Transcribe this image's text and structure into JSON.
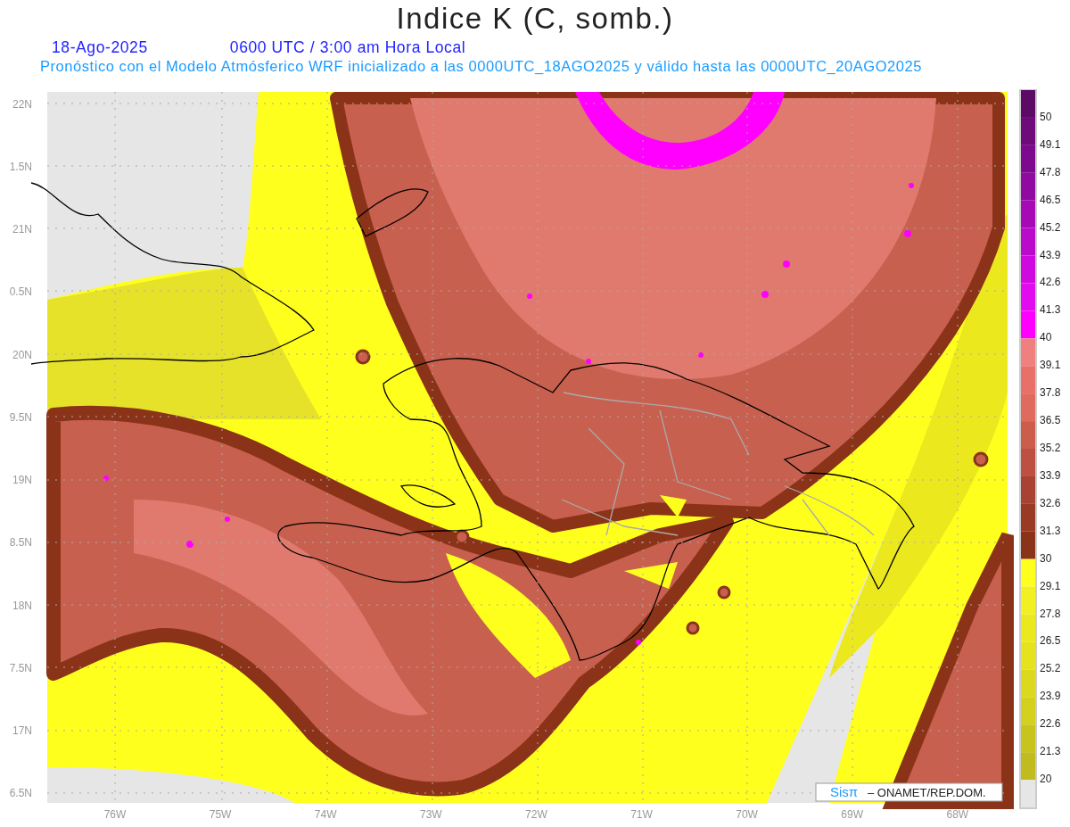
{
  "title": "Indice K (C, somb.)",
  "date": "18-Ago-2025",
  "time": "0600 UTC / 3:00 am Hora Local",
  "subtitle": "Pronóstico con el Modelo Atmósferico WRF inicializado a las 0000UTC_18AGO2025 y válido hasta las  0000UTC_20AGO2025",
  "map": {
    "y_ticks": [
      "22N",
      "1.5N",
      "21N",
      "0.5N",
      "20N",
      "9.5N",
      "19N",
      "8.5N",
      "18N",
      "7.5N",
      "17N",
      "6.5N"
    ],
    "x_ticks": [
      "76W",
      "75W",
      "74W",
      "73W",
      "72W",
      "71W",
      "70W",
      "69W",
      "68W"
    ]
  },
  "colorbar": {
    "steps": [
      {
        "color": "#5c0a66"
      },
      {
        "color": "#6e0a7a"
      },
      {
        "color": "#7d0a8e"
      },
      {
        "color": "#900aa2"
      },
      {
        "color": "#a50ab6"
      },
      {
        "color": "#ba0aca"
      },
      {
        "color": "#cf0ade"
      },
      {
        "color": "#e20aee"
      },
      {
        "color": "#ff00ff"
      },
      {
        "color": "#f08080"
      },
      {
        "color": "#e87068"
      },
      {
        "color": "#e06a5e"
      },
      {
        "color": "#cc5c4c"
      },
      {
        "color": "#bd5040"
      },
      {
        "color": "#a84232"
      },
      {
        "color": "#983a24"
      },
      {
        "color": "#8b3318"
      },
      {
        "color": "#ffff1e"
      },
      {
        "color": "#f2f020"
      },
      {
        "color": "#ece81e"
      },
      {
        "color": "#e6e21e"
      },
      {
        "color": "#dcd81e"
      },
      {
        "color": "#d4d01e"
      },
      {
        "color": "#c8c41e"
      },
      {
        "color": "#c0bc1e"
      },
      {
        "color": "#e6e6e6"
      }
    ],
    "labels": [
      "50",
      "49.1",
      "47.8",
      "46.5",
      "45.2",
      "43.9",
      "42.6",
      "41.3",
      "40",
      "39.1",
      "37.8",
      "36.5",
      "35.2",
      "33.9",
      "32.6",
      "31.3",
      "30",
      "29.1",
      "27.8",
      "26.5",
      "25.2",
      "23.9",
      "22.6",
      "21.3",
      "20"
    ]
  },
  "credit": {
    "logo": "Sisπ",
    "text": "– ONAMET/REP.DOM."
  }
}
